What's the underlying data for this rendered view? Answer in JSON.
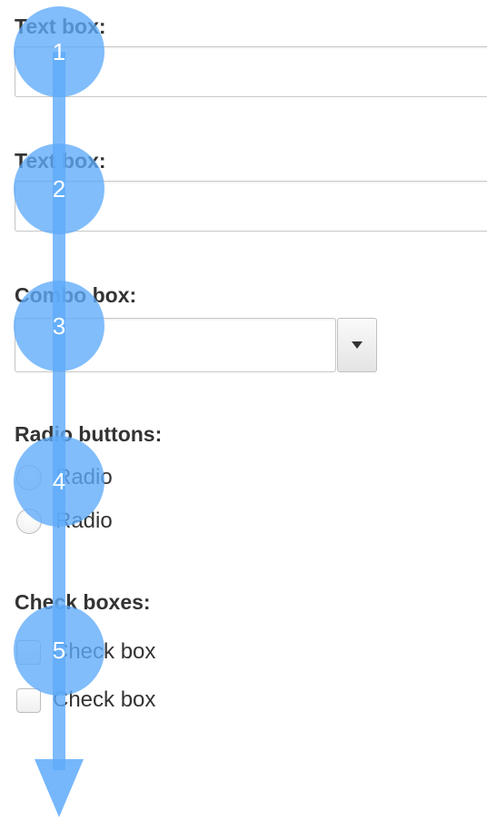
{
  "form": {
    "text_box_1": {
      "label": "Text box:",
      "value": ""
    },
    "text_box_2": {
      "label": "Text box:",
      "value": ""
    },
    "combo_box": {
      "label": "Combo box:",
      "value": "",
      "toggle_icon": "triangle-down-icon"
    },
    "radio_group": {
      "label": "Radio buttons:",
      "options": [
        {
          "label": "Radio",
          "checked": false
        },
        {
          "label": "Radio",
          "checked": false
        }
      ]
    },
    "checkbox_group": {
      "label": "Check boxes:",
      "options": [
        {
          "label": "Check box",
          "checked": false
        },
        {
          "label": "Check box",
          "checked": false
        }
      ]
    }
  },
  "tab_order_overlay": {
    "color": "#5eaafa",
    "markers": [
      {
        "number": "1"
      },
      {
        "number": "2"
      },
      {
        "number": "3"
      },
      {
        "number": "4"
      },
      {
        "number": "5"
      }
    ],
    "end_icon": "arrow-down-icon"
  }
}
